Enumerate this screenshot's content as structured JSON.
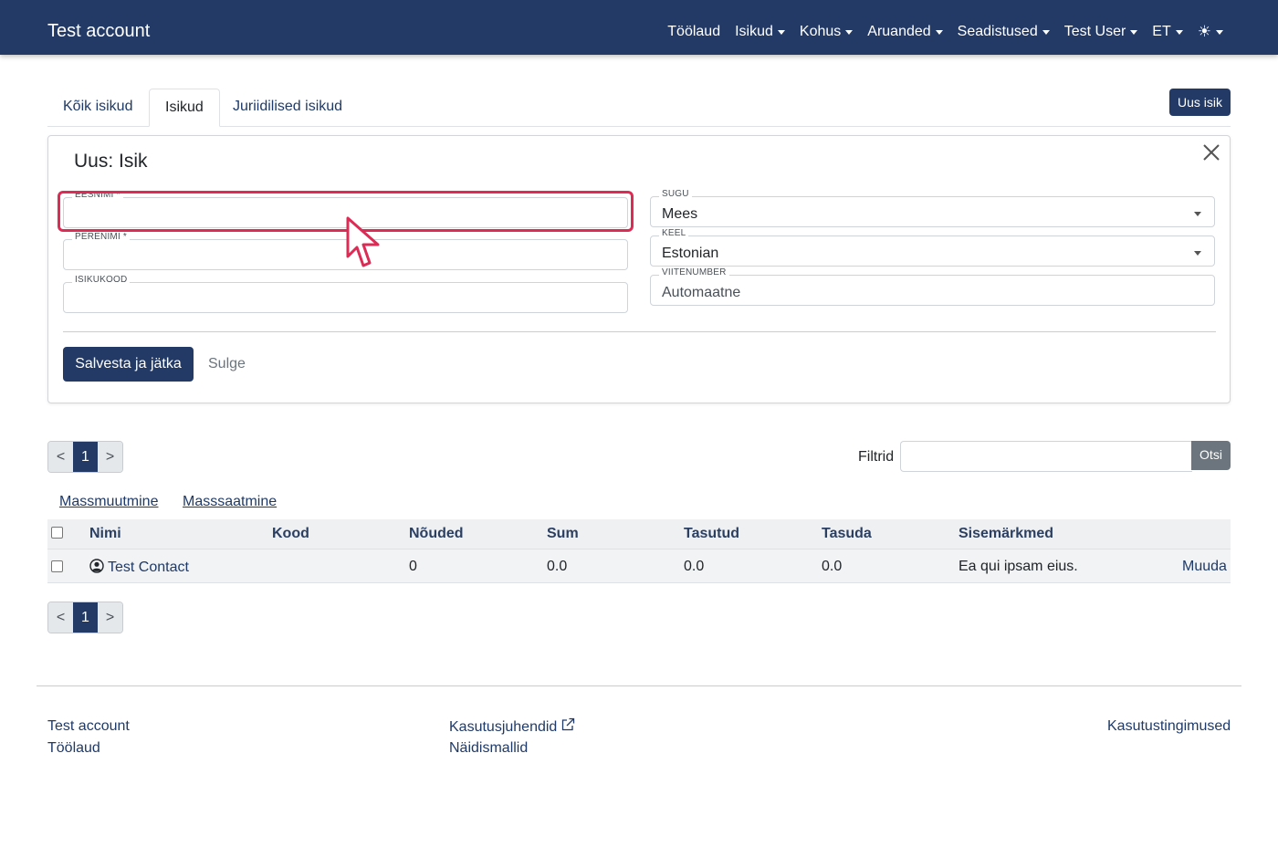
{
  "navbar": {
    "brand": "Test account",
    "items": [
      {
        "label": "Töölaud",
        "dropdown": false
      },
      {
        "label": "Isikud",
        "dropdown": true
      },
      {
        "label": "Kohus",
        "dropdown": true
      },
      {
        "label": "Aruanded",
        "dropdown": true
      },
      {
        "label": "Seadistused",
        "dropdown": true
      },
      {
        "label": "Test User",
        "dropdown": true
      },
      {
        "label": "ET",
        "dropdown": true
      }
    ],
    "theme_icon": "☀"
  },
  "tabs": [
    {
      "label": "Kõik isikud",
      "active": false
    },
    {
      "label": "Isikud",
      "active": true
    },
    {
      "label": "Juriidilised isikud",
      "active": false
    }
  ],
  "new_button": "Uus isik",
  "form": {
    "title": "Uus: Isik",
    "fields": {
      "eesnimi": {
        "label": "EESNIMI *",
        "value": ""
      },
      "perenimi": {
        "label": "PERENIMI *",
        "value": ""
      },
      "isikukood": {
        "label": "ISIKUKOOD",
        "value": ""
      },
      "sugu": {
        "label": "SUGU",
        "value": "Mees"
      },
      "keel": {
        "label": "KEEL",
        "value": "Estonian"
      },
      "viitenumber": {
        "label": "VIITENUMBER",
        "value": "Automaatne"
      }
    },
    "save_label": "Salvesta ja jätka",
    "close_label": "Sulge"
  },
  "pagination": {
    "prev": "<",
    "current": "1",
    "next": ">"
  },
  "filter": {
    "label": "Filtrid",
    "value": "",
    "button": "Otsi"
  },
  "mass_actions": [
    "Massmuutmine",
    "Masssaatmine"
  ],
  "table": {
    "headers": [
      "Nimi",
      "Kood",
      "Nõuded",
      "Sum",
      "Tasutud",
      "Tasuda",
      "Sisemärkmed"
    ],
    "rows": [
      {
        "name": "Test Contact",
        "kood": "",
        "nouded": "0",
        "sum": "0.0",
        "tasutud": "0.0",
        "tasuda": "0.0",
        "sisemarkmed": "Ea qui ipsam eius.",
        "action": "Muuda"
      }
    ]
  },
  "footer": {
    "col1": [
      "Test account",
      "Töölaud"
    ],
    "col2": [
      "Kasutusjuhendid",
      "Näidismallid"
    ],
    "col3": [
      "Kasutustingimused"
    ]
  },
  "colors": {
    "primary": "#233a66",
    "highlight": "#dc2b55",
    "link": "#1f3a68"
  }
}
